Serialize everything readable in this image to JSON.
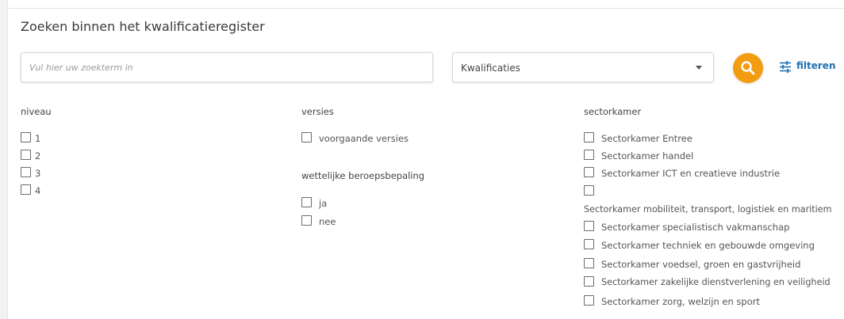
{
  "page": {
    "title": "Zoeken binnen het kwalificatieregister"
  },
  "search": {
    "placeholder": "Vul hier uw zoekterm in",
    "value": ""
  },
  "type_select": {
    "selected": "Kwalificaties"
  },
  "filter_link": {
    "label": "filteren",
    "icon": "tune-icon"
  },
  "colors": {
    "accent": "#f39c12",
    "link": "#1f6fb2"
  },
  "niveau": {
    "title": "niveau",
    "options": [
      "1",
      "2",
      "3",
      "4"
    ]
  },
  "versies": {
    "title": "versies",
    "options": [
      "voorgaande versies"
    ]
  },
  "wettelijke": {
    "title": "wettelijke beroepsbepaling",
    "options": [
      "ja",
      "nee"
    ]
  },
  "sectorkamer": {
    "title": "sectorkamer",
    "options": [
      "Sectorkamer Entree",
      "Sectorkamer handel",
      "Sectorkamer ICT en creatieve industrie",
      "Sectorkamer mobiliteit, transport, logistiek en maritiem",
      "Sectorkamer specialistisch vakmanschap",
      "Sectorkamer techniek en gebouwde omgeving",
      "Sectorkamer voedsel, groen en gastvrijheid",
      "Sectorkamer zakelijke dienstverlening en veiligheid",
      "Sectorkamer zorg, welzijn en sport"
    ]
  }
}
